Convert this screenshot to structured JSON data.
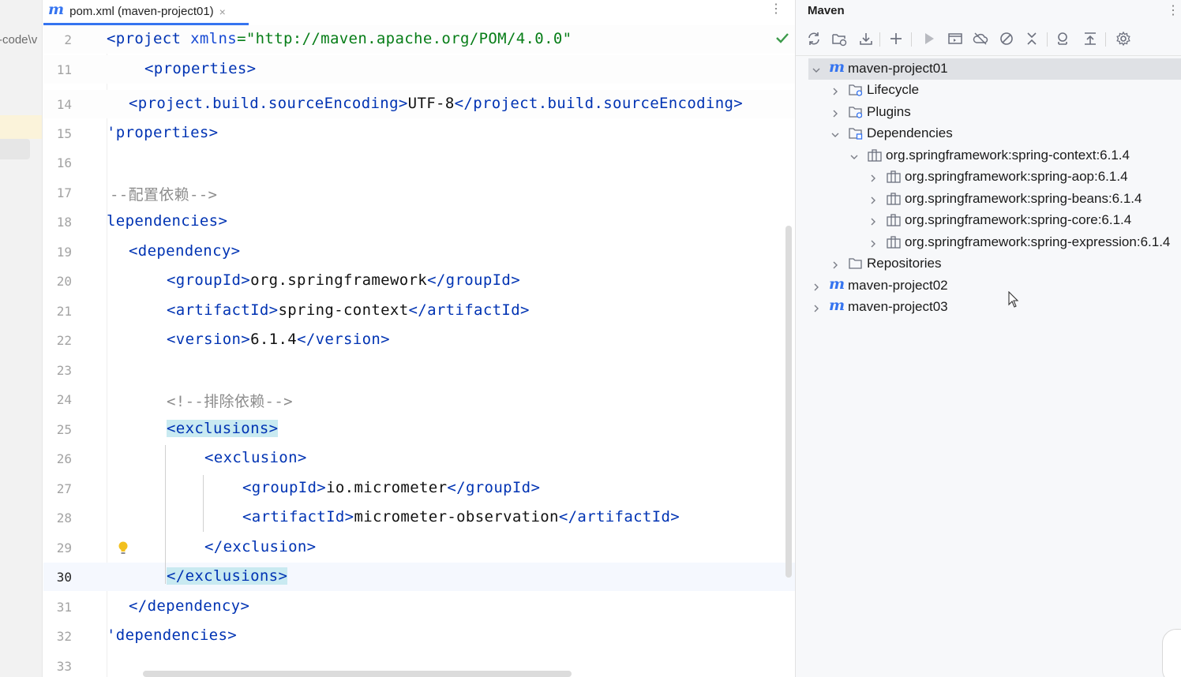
{
  "left_strip": {
    "crumb": "-code\\v"
  },
  "editor": {
    "tab": {
      "label": "pom.xml (maven-project01)",
      "icon_letter": "m",
      "close": "×"
    },
    "sticky_lines": [
      {
        "num": "2",
        "segments": [
          {
            "t": "<project ",
            "c": "tg"
          },
          {
            "t": "xmlns",
            "c": "at"
          },
          {
            "t": "=\"http://maven.apache.org/POM/4.0.0\"",
            "c": "sv"
          }
        ]
      },
      {
        "num": "11",
        "segments": [
          {
            "t": "<properties>",
            "c": "tg"
          }
        ]
      },
      {
        "num": "14",
        "segments": [
          {
            "t": "<project.build.sourceEncoding>",
            "c": "tg"
          },
          {
            "t": "UTF-8",
            "c": ""
          },
          {
            "t": "</project.build.sourceEncoding>",
            "c": "tg"
          }
        ]
      }
    ],
    "lines": [
      {
        "num": "15",
        "segments": [
          {
            "t": "'properties>",
            "c": "tg"
          }
        ]
      },
      {
        "num": "16",
        "segments": []
      },
      {
        "num": "17",
        "segments": [
          {
            "t": "--配置依赖-->",
            "c": "cm"
          }
        ]
      },
      {
        "num": "18",
        "segments": [
          {
            "t": "lependencies>",
            "c": "tg"
          }
        ]
      },
      {
        "num": "19",
        "segments": [
          {
            "t": "<dependency>",
            "c": "tg"
          }
        ]
      },
      {
        "num": "20",
        "segments": [
          {
            "t": "<groupId>",
            "c": "tg"
          },
          {
            "t": "org.springframework",
            "c": ""
          },
          {
            "t": "</groupId>",
            "c": "tg"
          }
        ]
      },
      {
        "num": "21",
        "segments": [
          {
            "t": "<artifactId>",
            "c": "tg"
          },
          {
            "t": "spring-context",
            "c": ""
          },
          {
            "t": "</artifactId>",
            "c": "tg"
          }
        ]
      },
      {
        "num": "22",
        "segments": [
          {
            "t": "<version>",
            "c": "tg"
          },
          {
            "t": "6.1.4",
            "c": ""
          },
          {
            "t": "</version>",
            "c": "tg"
          }
        ]
      },
      {
        "num": "23",
        "segments": []
      },
      {
        "num": "24",
        "segments": [
          {
            "t": "<!--排除依赖-->",
            "c": "cm"
          }
        ]
      },
      {
        "num": "25",
        "segments": [
          {
            "t": "<exclusions>",
            "c": "tg hlt"
          }
        ]
      },
      {
        "num": "26",
        "segments": [
          {
            "t": "<exclusion>",
            "c": "tg"
          }
        ]
      },
      {
        "num": "27",
        "segments": [
          {
            "t": "<groupId>",
            "c": "tg"
          },
          {
            "t": "io.micrometer",
            "c": ""
          },
          {
            "t": "</groupId>",
            "c": "tg"
          }
        ]
      },
      {
        "num": "28",
        "segments": [
          {
            "t": "<artifactId>",
            "c": "tg"
          },
          {
            "t": "micrometer-observation",
            "c": ""
          },
          {
            "t": "</artifactId>",
            "c": "tg"
          }
        ]
      },
      {
        "num": "29",
        "segments": [
          {
            "t": "</exclusion>",
            "c": "tg"
          }
        ]
      },
      {
        "num": "30",
        "segments": [
          {
            "t": "</exclusions>",
            "c": "tg hlt"
          }
        ],
        "current": true
      },
      {
        "num": "31",
        "segments": [
          {
            "t": "</dependency>",
            "c": "tg"
          }
        ]
      },
      {
        "num": "32",
        "segments": [
          {
            "t": "'dependencies>",
            "c": "tg"
          }
        ]
      },
      {
        "num": "33",
        "segments": []
      }
    ]
  },
  "maven": {
    "title": "Maven",
    "toolbar": [
      "reload-icon",
      "add-folder-icon",
      "download-icon",
      "plus-icon",
      "run-icon",
      "execute-goal-icon",
      "offline-icon",
      "skip-tests-icon",
      "collapse-icon",
      "dependency-analyzer-icon",
      "show-dependencies-icon",
      "settings-icon"
    ],
    "tree": [
      {
        "label": "maven-project01",
        "icon": "maven-m",
        "expanded": true,
        "selected": true
      },
      {
        "label": "Lifecycle",
        "icon": "folder-gear",
        "expanded": false
      },
      {
        "label": "Plugins",
        "icon": "folder-gear",
        "expanded": false
      },
      {
        "label": "Dependencies",
        "icon": "folder-lib",
        "expanded": true
      },
      {
        "label": "org.springframework:spring-context:6.1.4",
        "icon": "library",
        "expanded": true
      },
      {
        "label": "org.springframework:spring-aop:6.1.4",
        "icon": "library",
        "expanded": false
      },
      {
        "label": "org.springframework:spring-beans:6.1.4",
        "icon": "library",
        "expanded": false
      },
      {
        "label": "org.springframework:spring-core:6.1.4",
        "icon": "library",
        "expanded": false
      },
      {
        "label": "org.springframework:spring-expression:6.1.4",
        "icon": "library",
        "expanded": false
      },
      {
        "label": "Repositories",
        "icon": "folder",
        "expanded": false
      },
      {
        "label": "maven-project02",
        "icon": "maven-m",
        "expanded": false
      },
      {
        "label": "maven-project03",
        "icon": "maven-m",
        "expanded": false
      }
    ]
  },
  "colors": {
    "accent": "#3574f0",
    "tag": "#0033b3",
    "string": "#067d17",
    "comment": "#8c8c8c",
    "tag_highlight": "#c9eaf1"
  }
}
